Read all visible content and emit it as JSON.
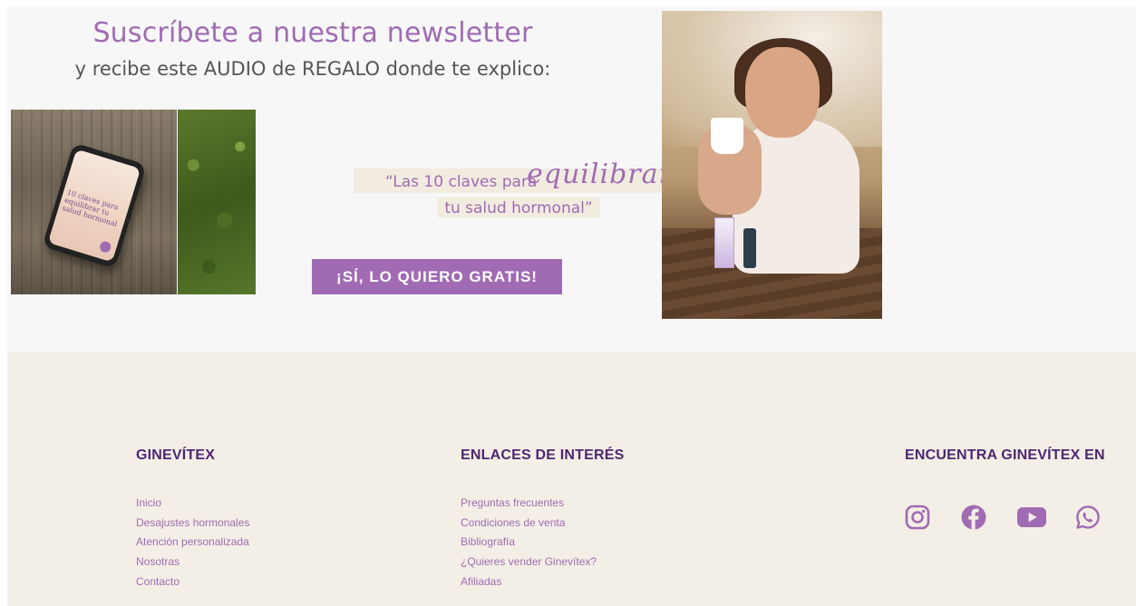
{
  "newsletter": {
    "title": "Suscríbete a nuestra newsletter",
    "subtitle": "y recibe este AUDIO de REGALO donde te explico:",
    "quote_line1": "“Las 10 claves para",
    "quote_script": "equilibrar",
    "quote_line2": "tu salud hormonal”",
    "cta_label": "¡SÍ, LO QUIERO GRATIS!",
    "phone_cover_text": "10 claves para equilibrar tu salud hormonal"
  },
  "footer": {
    "brand": {
      "heading": "GINEVÍTEX",
      "links": [
        "Inicio",
        "Desajustes hormonales",
        "Atención personalizada",
        "Nosotras",
        "Contacto"
      ]
    },
    "interest": {
      "heading": "ENLACES DE INTERÉS",
      "links": [
        "Preguntas frecuentes",
        "Condiciones de venta",
        "Bibliografía",
        "¿Quieres vender Ginevítex?",
        "Afiliadas"
      ]
    },
    "social": {
      "heading": "ENCUENTRA GINEVÍTEX EN",
      "icons": [
        "instagram-icon",
        "facebook-icon",
        "youtube-icon",
        "whatsapp-icon"
      ]
    }
  },
  "colors": {
    "accent": "#a06bb3",
    "heading": "#4f2673",
    "footer_bg": "#f4efe6",
    "newsletter_bg": "#f7f7f7"
  }
}
